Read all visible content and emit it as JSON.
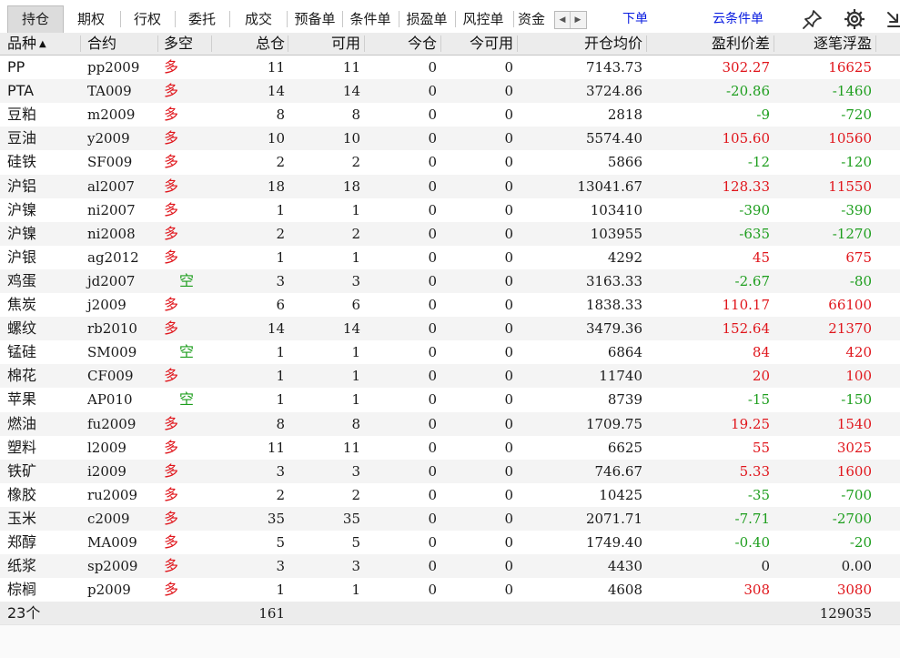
{
  "tabs": [
    {
      "label": "持仓",
      "active": true
    },
    {
      "label": "期权",
      "active": false
    },
    {
      "label": "行权",
      "active": false
    },
    {
      "label": "委托",
      "active": false
    },
    {
      "label": "成交",
      "active": false
    },
    {
      "label": "预备单",
      "active": false
    },
    {
      "label": "条件单",
      "active": false
    },
    {
      "label": "损盈单",
      "active": false
    },
    {
      "label": "风控单",
      "active": false
    },
    {
      "label": "资金",
      "active": false
    }
  ],
  "actions": {
    "place_order": "下单",
    "cloud_condition": "云条件单"
  },
  "toolbar_icons": [
    "pin-icon",
    "gear-icon",
    "collapse-arrow-icon"
  ],
  "columns": [
    "品种",
    "合约",
    "多空",
    "总仓",
    "可用",
    "今仓",
    "今可用",
    "开仓均价",
    "盈利价差",
    "逐笔浮盈"
  ],
  "sort_indicator": "▲",
  "colors": {
    "long": "#e0161c",
    "short": "#1e9e1e",
    "profit": "#e0161c",
    "loss": "#1e9e1e",
    "link": "#0a1de0"
  },
  "rows": [
    {
      "product": "PP",
      "contract": "pp2009",
      "side": "多",
      "total": "11",
      "avail": "11",
      "today": "0",
      "today_avail": "0",
      "avg_price": "7143.73",
      "profit_diff": "302.27",
      "float_pnl": "16625"
    },
    {
      "product": "PTA",
      "contract": "TA009",
      "side": "多",
      "total": "14",
      "avail": "14",
      "today": "0",
      "today_avail": "0",
      "avg_price": "3724.86",
      "profit_diff": "-20.86",
      "float_pnl": "-1460"
    },
    {
      "product": "豆粕",
      "contract": "m2009",
      "side": "多",
      "total": "8",
      "avail": "8",
      "today": "0",
      "today_avail": "0",
      "avg_price": "2818",
      "profit_diff": "-9",
      "float_pnl": "-720"
    },
    {
      "product": "豆油",
      "contract": "y2009",
      "side": "多",
      "total": "10",
      "avail": "10",
      "today": "0",
      "today_avail": "0",
      "avg_price": "5574.40",
      "profit_diff": "105.60",
      "float_pnl": "10560"
    },
    {
      "product": "硅铁",
      "contract": "SF009",
      "side": "多",
      "total": "2",
      "avail": "2",
      "today": "0",
      "today_avail": "0",
      "avg_price": "5866",
      "profit_diff": "-12",
      "float_pnl": "-120"
    },
    {
      "product": "沪铝",
      "contract": "al2007",
      "side": "多",
      "total": "18",
      "avail": "18",
      "today": "0",
      "today_avail": "0",
      "avg_price": "13041.67",
      "profit_diff": "128.33",
      "float_pnl": "11550"
    },
    {
      "product": "沪镍",
      "contract": "ni2007",
      "side": "多",
      "total": "1",
      "avail": "1",
      "today": "0",
      "today_avail": "0",
      "avg_price": "103410",
      "profit_diff": "-390",
      "float_pnl": "-390"
    },
    {
      "product": "沪镍",
      "contract": "ni2008",
      "side": "多",
      "total": "2",
      "avail": "2",
      "today": "0",
      "today_avail": "0",
      "avg_price": "103955",
      "profit_diff": "-635",
      "float_pnl": "-1270"
    },
    {
      "product": "沪银",
      "contract": "ag2012",
      "side": "多",
      "total": "1",
      "avail": "1",
      "today": "0",
      "today_avail": "0",
      "avg_price": "4292",
      "profit_diff": "45",
      "float_pnl": "675"
    },
    {
      "product": "鸡蛋",
      "contract": "jd2007",
      "side": "空",
      "total": "3",
      "avail": "3",
      "today": "0",
      "today_avail": "0",
      "avg_price": "3163.33",
      "profit_diff": "-2.67",
      "float_pnl": "-80"
    },
    {
      "product": "焦炭",
      "contract": "j2009",
      "side": "多",
      "total": "6",
      "avail": "6",
      "today": "0",
      "today_avail": "0",
      "avg_price": "1838.33",
      "profit_diff": "110.17",
      "float_pnl": "66100"
    },
    {
      "product": "螺纹",
      "contract": "rb2010",
      "side": "多",
      "total": "14",
      "avail": "14",
      "today": "0",
      "today_avail": "0",
      "avg_price": "3479.36",
      "profit_diff": "152.64",
      "float_pnl": "21370"
    },
    {
      "product": "锰硅",
      "contract": "SM009",
      "side": "空",
      "total": "1",
      "avail": "1",
      "today": "0",
      "today_avail": "0",
      "avg_price": "6864",
      "profit_diff": "84",
      "float_pnl": "420"
    },
    {
      "product": "棉花",
      "contract": "CF009",
      "side": "多",
      "total": "1",
      "avail": "1",
      "today": "0",
      "today_avail": "0",
      "avg_price": "11740",
      "profit_diff": "20",
      "float_pnl": "100"
    },
    {
      "product": "苹果",
      "contract": "AP010",
      "side": "空",
      "total": "1",
      "avail": "1",
      "today": "0",
      "today_avail": "0",
      "avg_price": "8739",
      "profit_diff": "-15",
      "float_pnl": "-150"
    },
    {
      "product": "燃油",
      "contract": "fu2009",
      "side": "多",
      "total": "8",
      "avail": "8",
      "today": "0",
      "today_avail": "0",
      "avg_price": "1709.75",
      "profit_diff": "19.25",
      "float_pnl": "1540"
    },
    {
      "product": "塑料",
      "contract": "l2009",
      "side": "多",
      "total": "11",
      "avail": "11",
      "today": "0",
      "today_avail": "0",
      "avg_price": "6625",
      "profit_diff": "55",
      "float_pnl": "3025"
    },
    {
      "product": "铁矿",
      "contract": "i2009",
      "side": "多",
      "total": "3",
      "avail": "3",
      "today": "0",
      "today_avail": "0",
      "avg_price": "746.67",
      "profit_diff": "5.33",
      "float_pnl": "1600"
    },
    {
      "product": "橡胶",
      "contract": "ru2009",
      "side": "多",
      "total": "2",
      "avail": "2",
      "today": "0",
      "today_avail": "0",
      "avg_price": "10425",
      "profit_diff": "-35",
      "float_pnl": "-700"
    },
    {
      "product": "玉米",
      "contract": "c2009",
      "side": "多",
      "total": "35",
      "avail": "35",
      "today": "0",
      "today_avail": "0",
      "avg_price": "2071.71",
      "profit_diff": "-7.71",
      "float_pnl": "-2700"
    },
    {
      "product": "郑醇",
      "contract": "MA009",
      "side": "多",
      "total": "5",
      "avail": "5",
      "today": "0",
      "today_avail": "0",
      "avg_price": "1749.40",
      "profit_diff": "-0.40",
      "float_pnl": "-20"
    },
    {
      "product": "纸浆",
      "contract": "sp2009",
      "side": "多",
      "total": "3",
      "avail": "3",
      "today": "0",
      "today_avail": "0",
      "avg_price": "4430",
      "profit_diff": "0",
      "float_pnl": "0.00"
    },
    {
      "product": "棕榈",
      "contract": "p2009",
      "side": "多",
      "total": "1",
      "avail": "1",
      "today": "0",
      "today_avail": "0",
      "avg_price": "4608",
      "profit_diff": "308",
      "float_pnl": "3080"
    }
  ],
  "summary": {
    "count": "23个",
    "total": "161",
    "float_pnl": "129035"
  }
}
